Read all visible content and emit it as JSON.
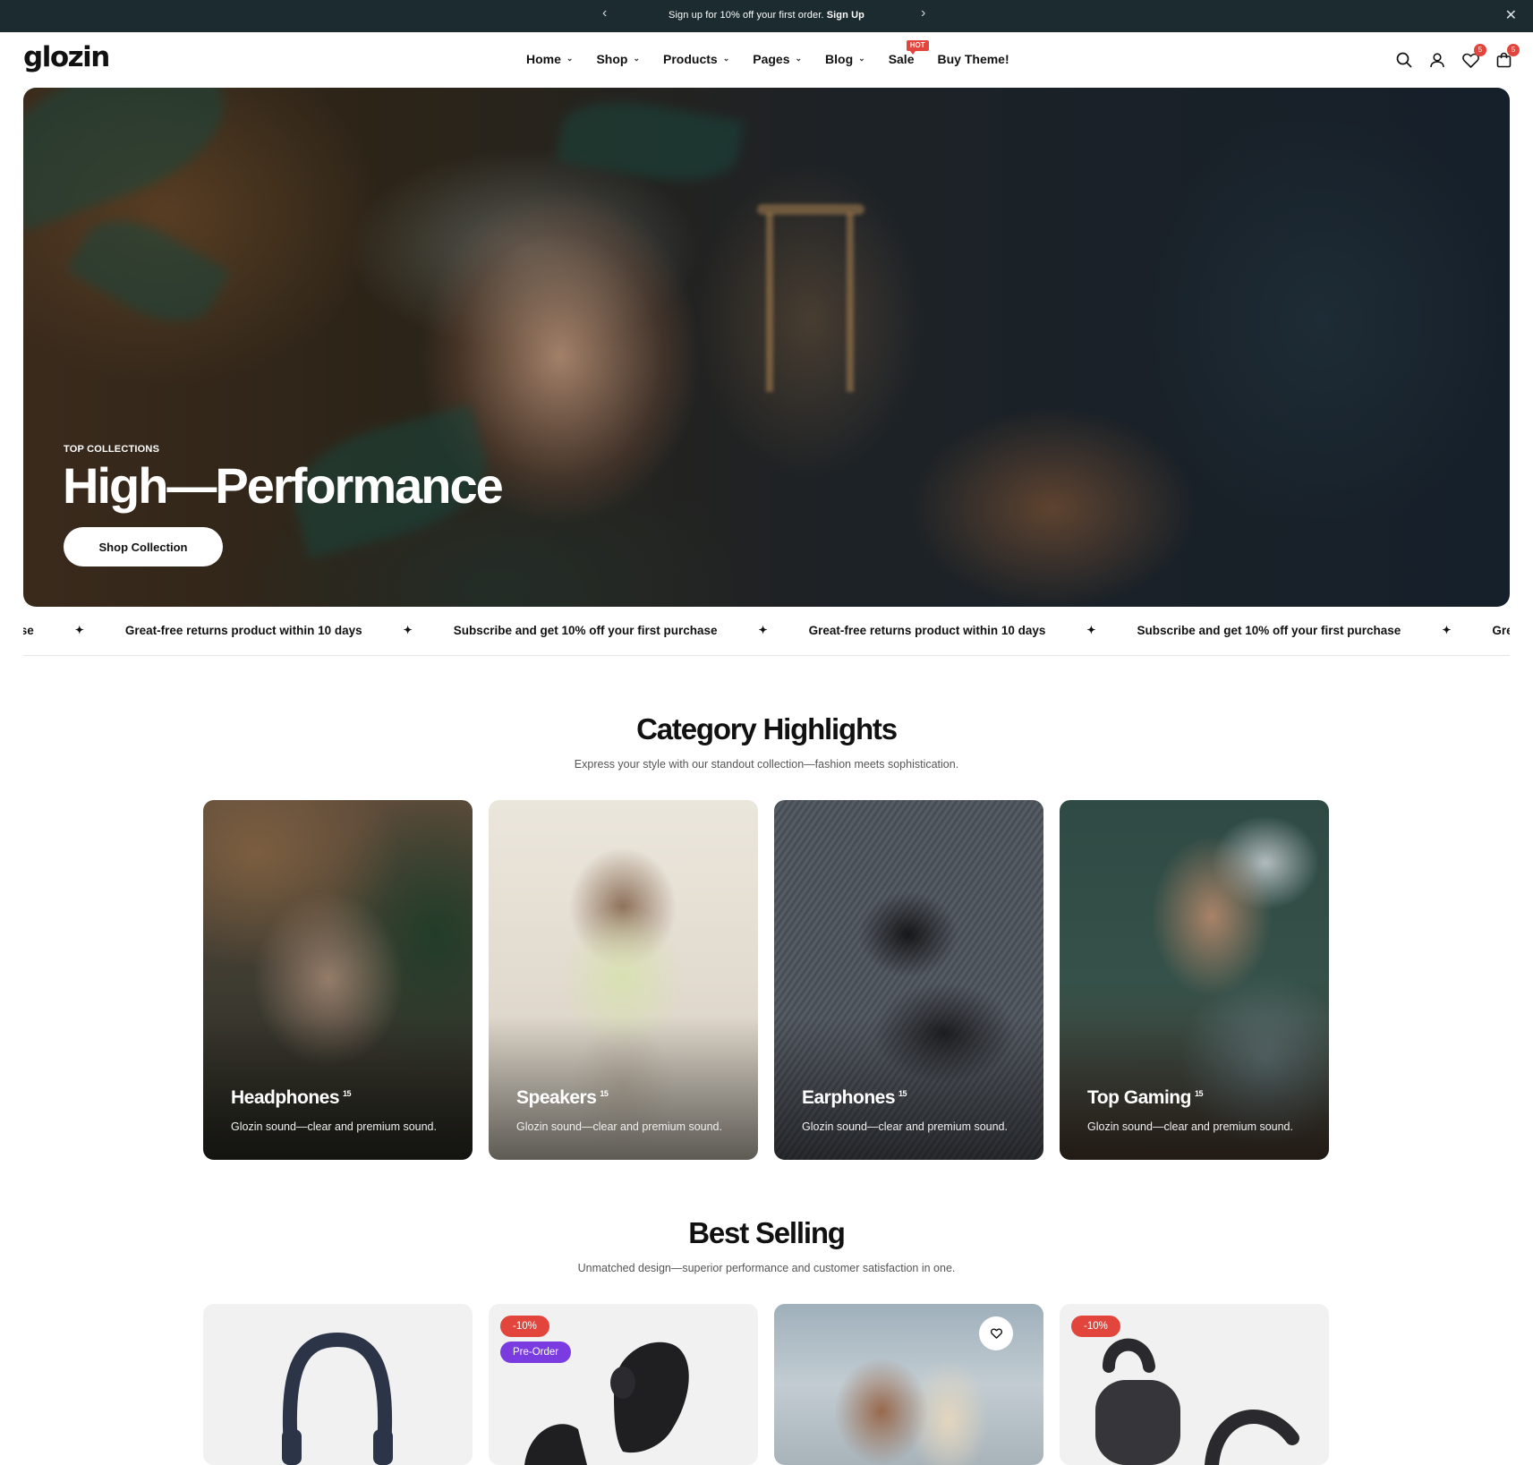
{
  "announcement": {
    "text": "Sign up for 10% off your first order.",
    "link": "Sign Up",
    "prev": "‹",
    "next": "›",
    "close": "✕"
  },
  "header": {
    "logo": "glozin",
    "nav": [
      {
        "label": "Home"
      },
      {
        "label": "Shop"
      },
      {
        "label": "Products"
      },
      {
        "label": "Pages"
      },
      {
        "label": "Blog"
      },
      {
        "label": "Sale",
        "badge": "HOT"
      },
      {
        "label": "Buy Theme!"
      }
    ],
    "icons": [
      "search-icon",
      "account-icon",
      "wishlist-icon",
      "cart-icon"
    ],
    "wishlist_count": "5",
    "cart_count": "5"
  },
  "hero": {
    "eyebrow": "TOP COLLECTIONS",
    "title": "High—Performance",
    "cta": "Shop Collection"
  },
  "marquee": {
    "items": [
      "urchase",
      "Great-free returns product within 10 days",
      "Subscribe and get 10% off your first purchase",
      "Great-free returns product within 10 days",
      "Subscribe and get 10% off your first purchase",
      "Grea"
    ],
    "separator": "✦"
  },
  "categories": {
    "title": "Category Highlights",
    "subtitle": "Express your style with our standout collection—fashion meets sophistication.",
    "items": [
      {
        "name": "Headphones",
        "count": "15",
        "desc": "Glozin sound—clear and premium sound."
      },
      {
        "name": "Speakers",
        "count": "15",
        "desc": "Glozin sound—clear and premium sound."
      },
      {
        "name": "Earphones",
        "count": "15",
        "desc": "Glozin sound—clear and premium sound."
      },
      {
        "name": "Top Gaming",
        "count": "15",
        "desc": "Glozin sound—clear and premium sound."
      }
    ]
  },
  "best_selling": {
    "title": "Best Selling",
    "subtitle": "Unmatched design—superior performance and customer satisfaction in one.",
    "products": [
      {
        "badges": []
      },
      {
        "badges": [
          "-10%",
          "Pre-Order"
        ]
      },
      {
        "badges": [],
        "wishlist": "heart-icon"
      },
      {
        "badges": [
          "-10%"
        ]
      }
    ]
  },
  "colors": {
    "announcement_bg": "#1b2b2f",
    "sale_badge": "#e2453c",
    "preorder_badge": "#7a3be0"
  }
}
